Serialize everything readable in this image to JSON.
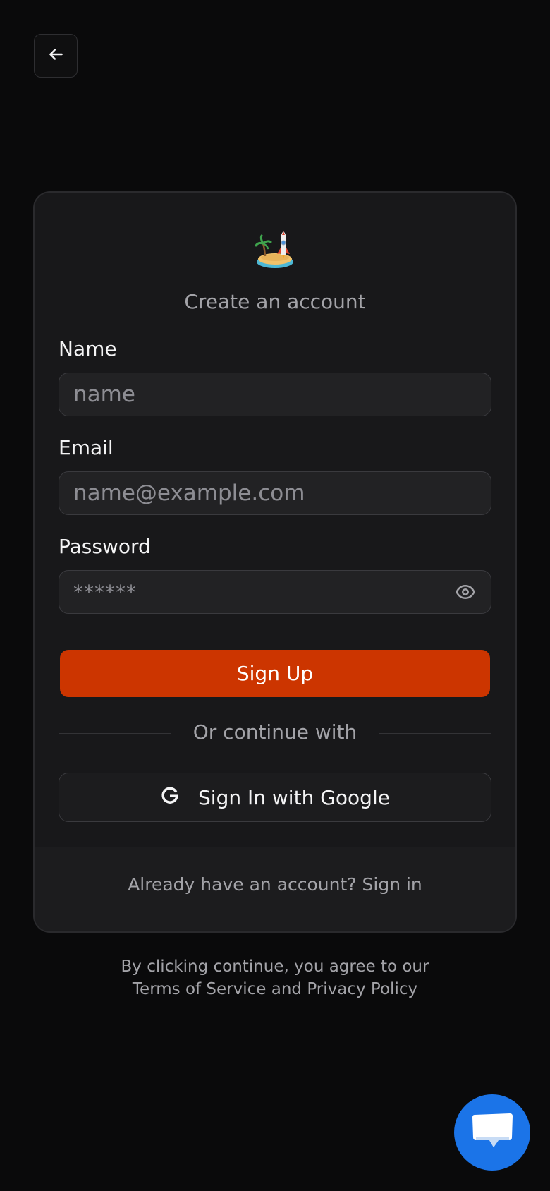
{
  "header": {
    "back_icon": "arrow-left-icon"
  },
  "card": {
    "logo_icon": "island-rocket-logo",
    "title": "Create an account",
    "name": {
      "label": "Name",
      "placeholder": "name",
      "value": ""
    },
    "email": {
      "label": "Email",
      "placeholder": "name@example.com",
      "value": ""
    },
    "password": {
      "label": "Password",
      "placeholder": "******",
      "value": "",
      "toggle_icon": "eye-icon"
    },
    "signup_label": "Sign Up",
    "divider_text": "Or continue with",
    "google": {
      "icon": "google-icon",
      "label": "Sign In with Google"
    },
    "footer": {
      "prefix": "Already have an account? ",
      "link": "Sign in"
    }
  },
  "terms": {
    "line1": "By clicking continue, you agree to our",
    "tos": "Terms of Service",
    "and": " and ",
    "privacy": "Privacy Policy"
  },
  "chat": {
    "icon": "chat-bubble-icon"
  },
  "colors": {
    "background": "#0a0a0b",
    "card": "#18181a",
    "accent": "#cc3500",
    "chat": "#1b74e8"
  }
}
